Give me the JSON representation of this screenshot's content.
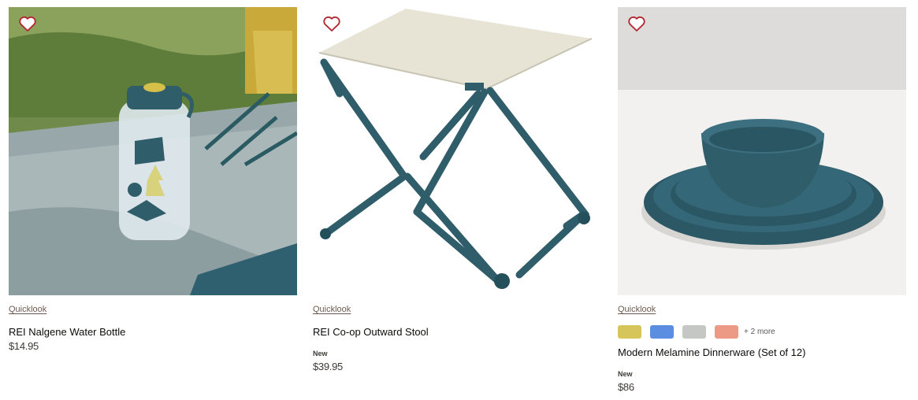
{
  "products": [
    {
      "name": "REI Nalgene Water Bottle",
      "price": "$14.95",
      "quicklook": "Quicklook",
      "image": "water-bottle-on-blanket"
    },
    {
      "name": "REI Co-op Outward Stool",
      "price": "$39.95",
      "badge": "New",
      "quicklook": "Quicklook",
      "image": "folding-stool"
    },
    {
      "name": "Modern Melamine Dinnerware (Set of 12)",
      "price": "$86",
      "badge": "New",
      "quicklook": "Quicklook",
      "image": "teal-dinnerware",
      "swatches": [
        "#d6c55a",
        "#5b8de0",
        "#c5c7c5",
        "#ec9a86"
      ],
      "more_colors": "+ 2 more"
    }
  ],
  "icons": {
    "favorite": "heart-outline-icon"
  },
  "colors": {
    "heart": "#b3262f",
    "quicklook": "#6d5a4f",
    "teal": "#2f5d6a"
  }
}
